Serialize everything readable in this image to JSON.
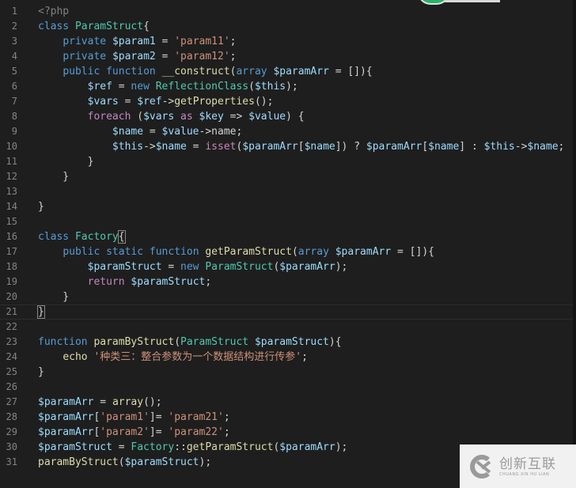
{
  "editor": {
    "language": "php",
    "current_line": 21,
    "lines": [
      {
        "n": "1",
        "code": "<?php"
      },
      {
        "n": "2",
        "code": "class ParamStruct{"
      },
      {
        "n": "3",
        "code": "    private $param1 = 'param11';"
      },
      {
        "n": "4",
        "code": "    private $param2 = 'param12';"
      },
      {
        "n": "5",
        "code": "    public function __construct(array $paramArr = []){"
      },
      {
        "n": "6",
        "code": "        $ref = new ReflectionClass($this);"
      },
      {
        "n": "7",
        "code": "        $vars = $ref->getProperties();"
      },
      {
        "n": "8",
        "code": "        foreach ($vars as $key => $value) {"
      },
      {
        "n": "9",
        "code": "            $name = $value->name;"
      },
      {
        "n": "10",
        "code": "            $this->$name = isset($paramArr[$name]) ? $paramArr[$name] : $this->$name;"
      },
      {
        "n": "11",
        "code": "        }"
      },
      {
        "n": "12",
        "code": "    }"
      },
      {
        "n": "13",
        "code": ""
      },
      {
        "n": "14",
        "code": "}"
      },
      {
        "n": "15",
        "code": ""
      },
      {
        "n": "16",
        "code": "class Factory{"
      },
      {
        "n": "17",
        "code": "    public static function getParamStruct(array $paramArr = []){"
      },
      {
        "n": "18",
        "code": "        $paramStruct = new ParamStruct($paramArr);"
      },
      {
        "n": "19",
        "code": "        return $paramStruct;"
      },
      {
        "n": "20",
        "code": "    }"
      },
      {
        "n": "21",
        "code": "}"
      },
      {
        "n": "22",
        "code": ""
      },
      {
        "n": "23",
        "code": "function paramByStruct(ParamStruct $paramStruct){"
      },
      {
        "n": "24",
        "code": "    echo '种类三：整合参数为一个数据结构进行传参';"
      },
      {
        "n": "25",
        "code": "}"
      },
      {
        "n": "26",
        "code": ""
      },
      {
        "n": "27",
        "code": "$paramArr = array();"
      },
      {
        "n": "28",
        "code": "$paramArr['param1']= 'param21';"
      },
      {
        "n": "29",
        "code": "$paramArr['param2']= 'param22';"
      },
      {
        "n": "30",
        "code": "$paramStruct = Factory::getParamStruct($paramArr);"
      },
      {
        "n": "31",
        "code": "paramByStruct($paramStruct);"
      }
    ]
  },
  "watermark": {
    "name_cn": "创新互联",
    "name_en": "CHUANG XIN HU LIAN"
  },
  "colors": {
    "background": "#1e1e1e",
    "keyword": "#569cd6",
    "control": "#c586c0",
    "variable": "#9cdcfe",
    "string": "#ce9178",
    "class": "#4ec9b0",
    "function": "#dcdcaa",
    "line_number": "#858585"
  }
}
